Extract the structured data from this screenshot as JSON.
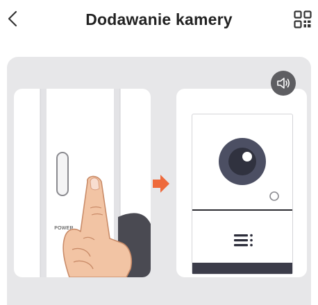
{
  "header": {
    "title": "Dodawanie kamery",
    "back_icon": "chevron-left-icon",
    "scan_icon": "qr-code-scan-icon"
  },
  "illustration": {
    "power_label": "POWER",
    "sound_icon": "speaker-icon",
    "arrow_icon": "arrow-right-icon",
    "accent_color": "#ee6a3c",
    "background_color": "#e7e7e9",
    "sound_button_color": "#5e5e62"
  }
}
